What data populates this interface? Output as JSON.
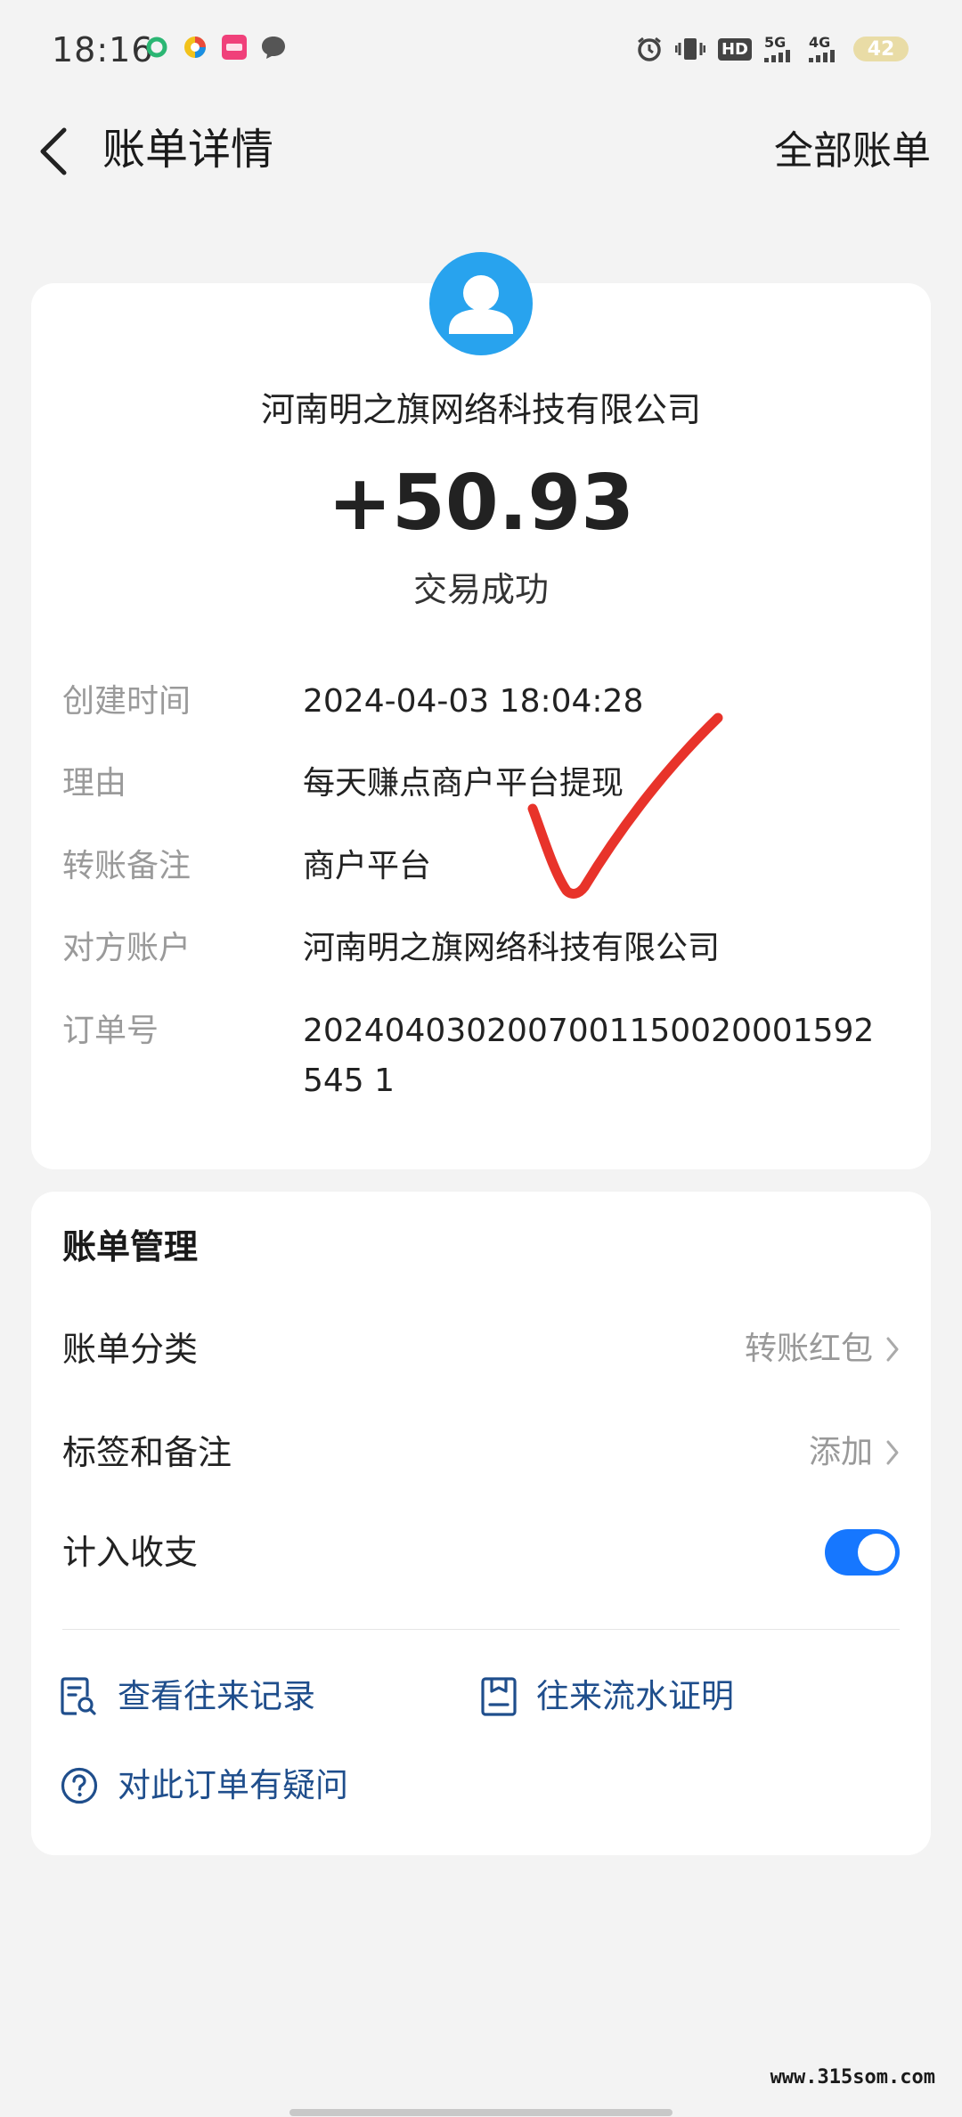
{
  "status_bar": {
    "time": "18:16",
    "hd_label": "HD",
    "network_5g": "5G",
    "network_4g": "4G",
    "battery": "42"
  },
  "header": {
    "title": "账单详情",
    "all_bills": "全部账单"
  },
  "summary": {
    "payee": "河南明之旗网络科技有限公司",
    "amount": "+50.93",
    "status": "交易成功"
  },
  "details": [
    {
      "label": "创建时间",
      "value": "2024-04-03 18:04:28"
    },
    {
      "label": "理由",
      "value": "每天赚点商户平台提现"
    },
    {
      "label": "转账备注",
      "value": "商户平台"
    },
    {
      "label": "对方账户",
      "value": "河南明之旗网络科技有限公司"
    },
    {
      "label": "订单号",
      "value": "2024040302007001150020001592545 1"
    }
  ],
  "management": {
    "title": "账单管理",
    "category_label": "账单分类",
    "category_value": "转账红包",
    "tags_label": "标签和备注",
    "tags_value": "添加",
    "include_label": "计入收支",
    "include_enabled": true
  },
  "links": {
    "records": "查看往来记录",
    "proof": "往来流水证明",
    "question": "对此订单有疑问"
  },
  "watermark": "www.315som.com",
  "colors": {
    "accent": "#1677ff",
    "link": "#1f4e8c",
    "avatar": "#28a3ee",
    "checkmark": "#e8332a"
  }
}
